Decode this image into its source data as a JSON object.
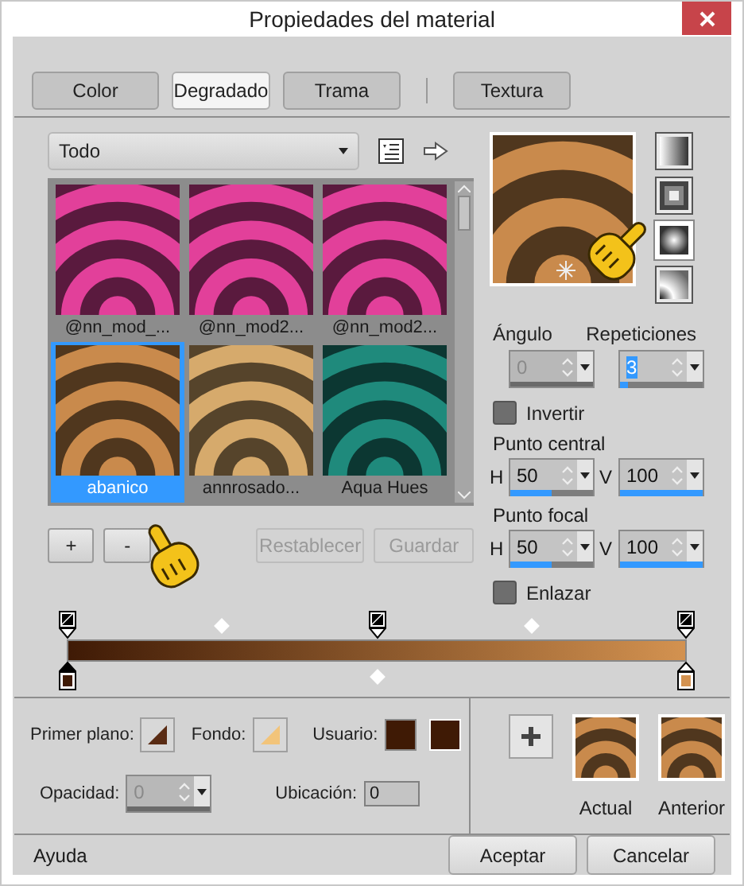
{
  "window": {
    "title": "Propiedades del material"
  },
  "tabs": [
    {
      "label": "Color",
      "selected": false
    },
    {
      "label": "Degradado",
      "selected": true
    },
    {
      "label": "Trama",
      "selected": false
    },
    {
      "label": "Textura",
      "selected": false
    }
  ],
  "category": {
    "value": "Todo"
  },
  "gallery": [
    {
      "name": "@nn_mod_...",
      "color": "#e2409a",
      "selected": false
    },
    {
      "name": "@nn_mod2...",
      "color": "#e2409a",
      "selected": false
    },
    {
      "name": "@nn_mod2...",
      "color": "#e2409a",
      "selected": false
    },
    {
      "name": "abanico",
      "color": "#c98a4c",
      "selected": true
    },
    {
      "name": "annrosado...",
      "color": "#d6aa6c",
      "selected": false
    },
    {
      "name": "Aqua Hues",
      "color": "#1f8a7c",
      "selected": false
    }
  ],
  "gallery_buttons": [
    {
      "label": "+",
      "disabled": false
    },
    {
      "label": "-",
      "disabled": false
    },
    {
      "label": "Restablecer",
      "disabled": true
    },
    {
      "label": "Guardar",
      "disabled": true
    }
  ],
  "styles": [
    {
      "kind": "linear",
      "selected": false
    },
    {
      "kind": "rectangular",
      "selected": false
    },
    {
      "kind": "radial",
      "selected": true
    },
    {
      "kind": "corner",
      "selected": false
    }
  ],
  "angle": {
    "label": "Ángulo",
    "value": "0",
    "disabled": true
  },
  "repeats": {
    "label": "Repeticiones",
    "value": "3",
    "disabled": false,
    "level": 0.1
  },
  "invert": {
    "label": "Invertir",
    "checked": false
  },
  "center": {
    "label": "Punto central",
    "h": {
      "axis": "H",
      "value": "50",
      "level": 0.5
    },
    "v": {
      "axis": "V",
      "value": "100",
      "level": 1
    }
  },
  "focal": {
    "label": "Punto focal",
    "h": {
      "axis": "H",
      "value": "50",
      "level": 0.5
    },
    "v": {
      "axis": "V",
      "value": "100",
      "level": 1
    }
  },
  "link": {
    "label": "Enlazar",
    "checked": false
  },
  "gradient": {
    "opacity_stops": [
      {
        "selected": false
      },
      {
        "selected": false
      },
      {
        "selected": false
      }
    ],
    "color_stops": [
      {
        "color": "#3f1a05",
        "selected": true
      },
      {
        "color": "#d39250",
        "selected": false
      }
    ]
  },
  "foreground": {
    "label": "Primer plano:",
    "color": "#5a2c14"
  },
  "background": {
    "label": "Fondo:",
    "color": "#f2c47a"
  },
  "user": {
    "label": "Usuario:",
    "swatches": [
      {
        "color": "#3f1a05"
      },
      {
        "color": "#3f1a05"
      }
    ]
  },
  "opacity": {
    "label": "Opacidad:",
    "value": "0",
    "disabled": true
  },
  "location": {
    "label": "Ubicación:",
    "value": "0"
  },
  "previews": [
    {
      "label": "Actual"
    },
    {
      "label": "Anterior"
    }
  ],
  "footer": {
    "help": "Ayuda",
    "buttons": [
      {
        "label": "Aceptar"
      },
      {
        "label": "Cancelar"
      }
    ]
  }
}
